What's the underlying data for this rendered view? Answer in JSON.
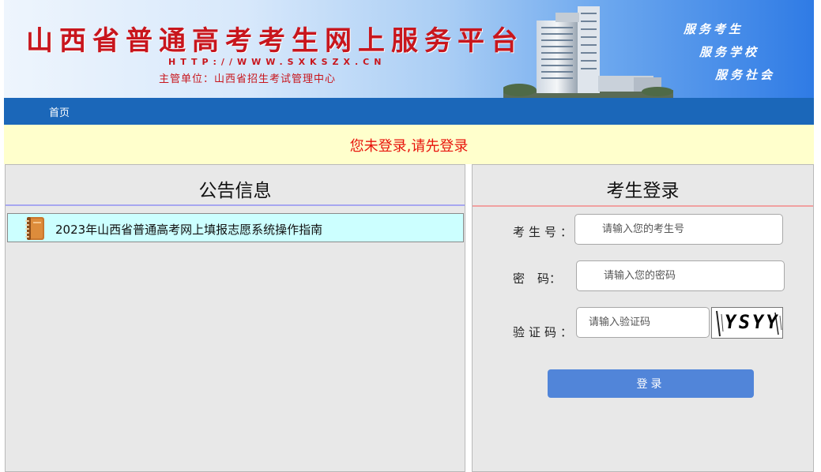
{
  "header": {
    "title": "山西省普通高考考生网上服务平台",
    "url": "HTTP://WWW.SXKSZX.CN",
    "organizer": "主管单位：山西省招生考试管理中心",
    "slogans": [
      "服务考生",
      "服务学校",
      "服务社会"
    ]
  },
  "nav": {
    "home": "首页"
  },
  "notice": {
    "message": "您未登录,请先登录"
  },
  "announcements": {
    "title": "公告信息",
    "items": [
      {
        "text": "2023年山西省普通高考网上填报志愿系统操作指南"
      }
    ]
  },
  "login": {
    "title": "考生登录",
    "candidate_label": "考生号：",
    "candidate_placeholder": "请输入您的考生号",
    "password_label_1": "密",
    "password_label_2": "码：",
    "password_placeholder": "请输入您的密码",
    "captcha_label": "验证码：",
    "captcha_placeholder": "请输入验证码",
    "captcha_text": "YSYY",
    "submit_label": "登录"
  },
  "colors": {
    "title_red": "#c8161d",
    "nav_blue": "#1b67b9",
    "notice_bg": "#ffffcc",
    "notice_text": "#e8140c",
    "button_blue": "#5185d9"
  }
}
